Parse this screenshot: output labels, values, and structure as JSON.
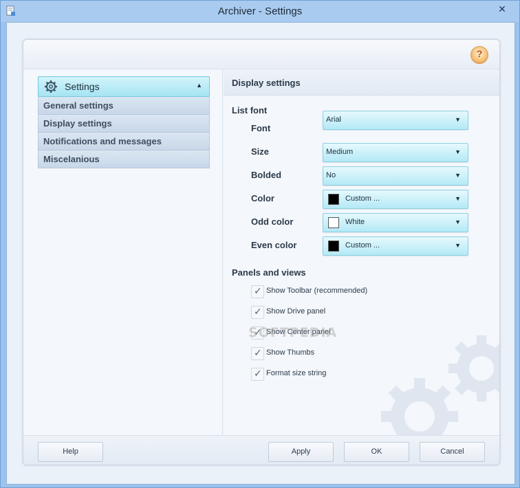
{
  "window": {
    "title": "Archiver - Settings",
    "close_glyph": "✕"
  },
  "help_orb": {
    "icon": "help-icon",
    "glyph": "?"
  },
  "nav": {
    "header_label": "Settings",
    "header_icon": "gear-icon",
    "items": [
      {
        "label": "General settings"
      },
      {
        "label": "Display settings"
      },
      {
        "label": "Notifications and messages"
      },
      {
        "label": "Miscelanious"
      }
    ]
  },
  "display": {
    "section_title": "Display settings",
    "list_font_title": "List font",
    "fields": {
      "font": {
        "label": "Font",
        "value": "Arial"
      },
      "size": {
        "label": "Size",
        "value": "Medium"
      },
      "bolded": {
        "label": "Bolded",
        "value": "No"
      },
      "color": {
        "label": "Color",
        "value": "Custom ...",
        "swatch": "#000000"
      },
      "odd_color": {
        "label": "Odd color",
        "value": "White",
        "swatch": "#ffffff"
      },
      "even_color": {
        "label": "Even color",
        "value": "Custom ...",
        "swatch": "#000000"
      }
    },
    "panels_title": "Panels and views",
    "checkboxes": [
      {
        "label": "Show Toolbar (recommended)",
        "checked": true
      },
      {
        "label": "Show Drive panel",
        "checked": true
      },
      {
        "label": "Show Center panel",
        "checked": true
      },
      {
        "label": "Show Thumbs",
        "checked": true
      },
      {
        "label": "Format size string",
        "checked": true
      }
    ],
    "watermark": "SOFTPEDIA"
  },
  "footer": {
    "help_label": "Help",
    "apply_label": "Apply",
    "ok_label": "OK",
    "cancel_label": "Cancel"
  },
  "colors": {
    "accent_cyan": "#a6e4f3",
    "frame_blue": "#9dc3ec"
  }
}
